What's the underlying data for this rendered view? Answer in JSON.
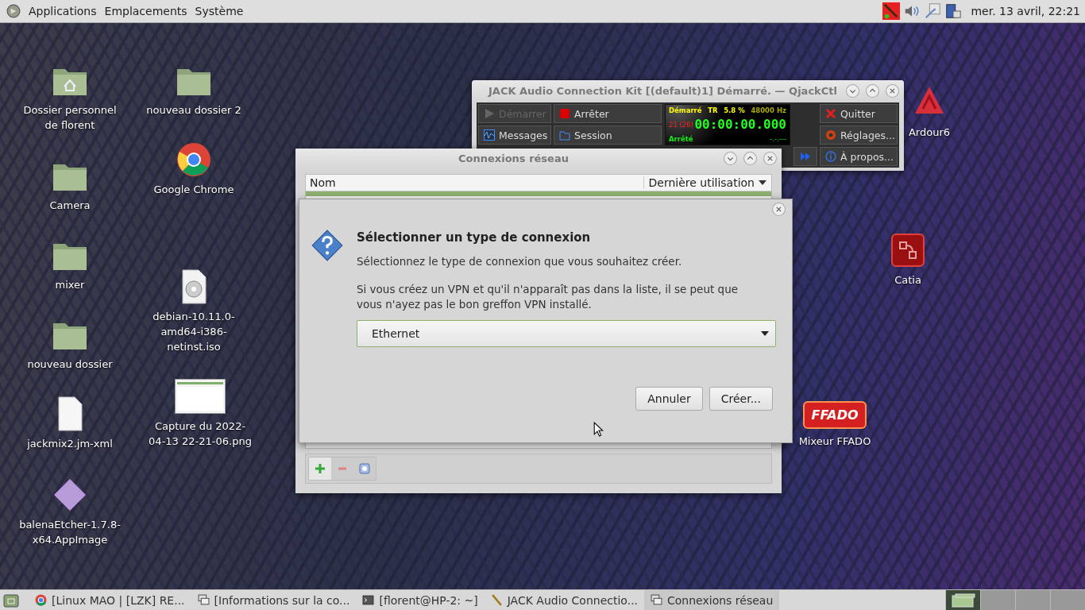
{
  "top_panel": {
    "menus": [
      "Applications",
      "Emplacements",
      "Système"
    ],
    "clock": "mer. 13 avril, 22:21"
  },
  "desktop_icons": [
    {
      "label": "Dossier personnel de florent",
      "kind": "home"
    },
    {
      "label": "Camera",
      "kind": "folder"
    },
    {
      "label": "mixer",
      "kind": "folder"
    },
    {
      "label": "nouveau dossier",
      "kind": "folder"
    },
    {
      "label": "jackmix2.jm-xml",
      "kind": "file"
    },
    {
      "label": "balenaEtcher-1.7.8-x64.AppImage",
      "kind": "etcher"
    },
    {
      "label": "nouveau dossier 2",
      "kind": "folder"
    },
    {
      "label": "Google Chrome",
      "kind": "chrome"
    },
    {
      "label": "debian-10.11.0-amd64-i386-netinst.iso",
      "kind": "disc"
    },
    {
      "label": "Capture du 2022-04-13 22-21-06.png",
      "kind": "image"
    },
    {
      "label": "Ardour6",
      "kind": "ardour"
    },
    {
      "label": "Catia",
      "kind": "catia"
    },
    {
      "label": "Mixeur FFADO",
      "kind": "ffado",
      "logo_text": "FFADO"
    }
  ],
  "jack_window": {
    "title": "JACK Audio Connection Kit [(default)1] Démarré. — QjackCtl",
    "left_buttons": [
      {
        "label": "Démarrer",
        "kind": "play",
        "disabled": true
      },
      {
        "label": "Arrêter",
        "kind": "stop",
        "disabled": false
      },
      {
        "label": "Messages",
        "kind": "messages",
        "disabled": false
      },
      {
        "label": "Session",
        "kind": "session",
        "disabled": false
      }
    ],
    "display": {
      "status": "Démarré",
      "mode": "TR",
      "load": "5.8 %",
      "rate": "48000 Hz",
      "xruns": "21 (26)",
      "time": "00:00:00.000",
      "transport": "Arrêté",
      "bbt": "-.-.---"
    },
    "right_buttons": [
      {
        "label": "Quitter",
        "kind": "quit"
      },
      {
        "label": "Réglages...",
        "kind": "settings"
      },
      {
        "label": "À propos...",
        "kind": "about"
      }
    ]
  },
  "network_window": {
    "title": "Connexions réseau",
    "columns": [
      "Nom",
      "Dernière utilisation"
    ]
  },
  "dialog": {
    "heading": "Sélectionner un type de connexion",
    "text": "Sélectionnez le type de connexion que vous souhaitez créer.",
    "note": "Si vous créez un VPN et qu'il n'apparaît pas dans la liste, il se peut que vous n'ayez pas le bon greffon VPN installé.",
    "connection_type": "Ethernet",
    "buttons": [
      "Annuler",
      "Créer..."
    ]
  },
  "taskbar": {
    "items": [
      {
        "label": "[Linux MAO | [LZK] RE...",
        "kind": "chrome",
        "selected": false
      },
      {
        "label": "[Informations sur la co...",
        "kind": "window",
        "selected": false
      },
      {
        "label": "[florent@HP-2: ~]",
        "kind": "terminal",
        "selected": false
      },
      {
        "label": "JACK Audio Connectio...",
        "kind": "jack",
        "selected": false
      },
      {
        "label": "Connexions réseau",
        "kind": "network",
        "selected": true
      }
    ],
    "workspaces": [
      {
        "selected": true
      },
      {
        "selected": false
      },
      {
        "selected": false
      },
      {
        "selected": false
      }
    ]
  }
}
